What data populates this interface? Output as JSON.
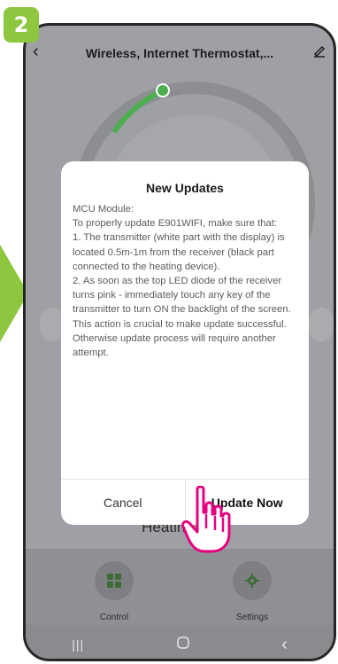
{
  "step": {
    "number": "2",
    "color": "#8dc63f"
  },
  "header": {
    "back_icon": "chevron-left-icon",
    "title": "Wireless, Internet Thermostat,...",
    "edit_icon": "pencil-icon"
  },
  "dialog": {
    "title": "New Updates",
    "lines": [
      "MCU Module:",
      "To properly update E901WIFI, make sure that:",
      "1. The transmitter (white part with the display) is located 0.5m-1m from the receiver (black part connected to the heating device).",
      "2. As soon as the top LED diode of the receiver turns pink - immediately touch any key of the transmitter to turn ON the backlight of the screen. This action is crucial to make update successful. Otherwise update process will require another attempt."
    ],
    "cancel_label": "Cancel",
    "update_label": "Update Now"
  },
  "status": {
    "heating_text": "Heating Off"
  },
  "tabs": [
    {
      "label": "Control",
      "icon": "grid-icon"
    },
    {
      "label": "Settings",
      "icon": "gear-icon"
    }
  ],
  "system_nav": {
    "recent": "|||",
    "home_icon": "home-icon",
    "back_icon": "back-icon"
  },
  "colors": {
    "accent_green": "#8dc63f",
    "dial_green": "#4caf50",
    "overlay_gray": "#9ea0a5"
  }
}
